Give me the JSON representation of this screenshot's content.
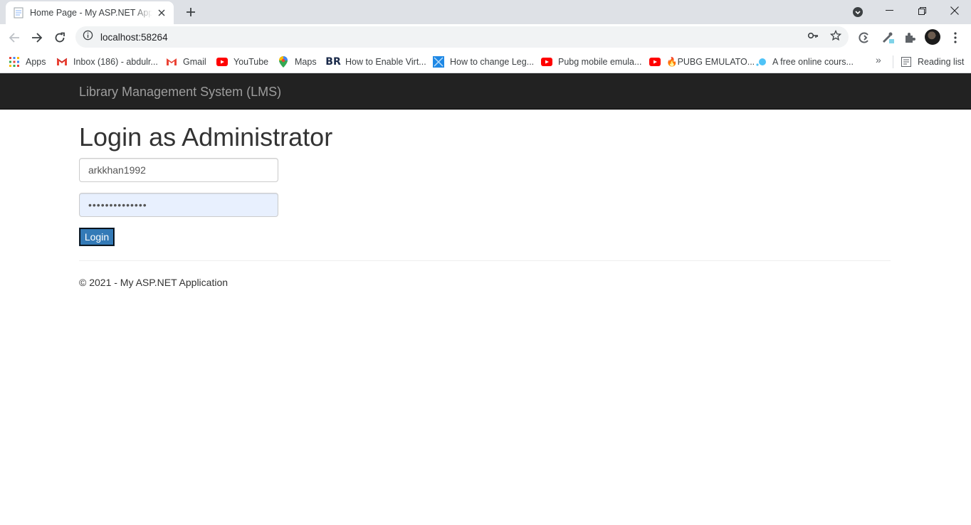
{
  "browser": {
    "tab_title": "Home Page - My ASP.NET Applic",
    "url": "localhost:58264",
    "bookmarks": [
      {
        "label": "Apps",
        "icon": "apps-grid-icon"
      },
      {
        "label": "Inbox (186) - abdulr...",
        "icon": "gmail-icon"
      },
      {
        "label": "Gmail",
        "icon": "gmail-icon"
      },
      {
        "label": "YouTube",
        "icon": "youtube-icon"
      },
      {
        "label": "Maps",
        "icon": "maps-pin-icon"
      },
      {
        "label": "How to Enable Virt...",
        "icon": "br-icon"
      },
      {
        "label": "How to change Leg...",
        "icon": "blue-square-icon"
      },
      {
        "label": "Pubg mobile emula...",
        "icon": "youtube-icon"
      },
      {
        "label": "🔥PUBG EMULATO...",
        "icon": "youtube-icon"
      },
      {
        "label": "A free online cours...",
        "icon": "dots-icon"
      }
    ],
    "reading_list_label": "Reading list",
    "more_bookmarks": "»",
    "colors": {
      "tabstrip": "#dee1e6",
      "omnibox": "#f1f3f4"
    }
  },
  "page": {
    "brand": "Library Management System (LMS)",
    "title": "Login as Administrator",
    "username_value": "arkkhan1992",
    "password_value": "••••••••••••••",
    "login_label": "Login",
    "footer": "© 2021 - My ASP.NET Application",
    "colors": {
      "navbar": "#222222",
      "brand": "#9d9d9d",
      "button": "#337ab7",
      "autofill": "#e8f0fe"
    }
  }
}
